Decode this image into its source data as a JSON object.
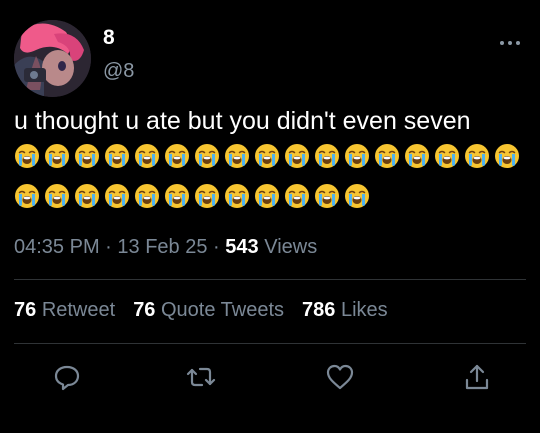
{
  "author": {
    "name": "8",
    "handle": "@8"
  },
  "tweet": {
    "text": "u thought u ate but you didn't even seven",
    "emoji_rows": [
      17,
      12
    ],
    "emoji_name": "loudly-crying-face"
  },
  "meta": {
    "time": "04:35 PM",
    "sep": "·",
    "date": "13 Feb 25",
    "views_count": "543",
    "views_label": "Views"
  },
  "stats": {
    "retweets": {
      "count": "76",
      "label": "Retweet"
    },
    "quotes": {
      "count": "76",
      "label": "Quote Tweets"
    },
    "likes": {
      "count": "786",
      "label": "Likes"
    }
  },
  "colors": {
    "background": "#000000",
    "muted": "#7b8896",
    "divider": "#2f3336",
    "text": "#ffffff"
  }
}
